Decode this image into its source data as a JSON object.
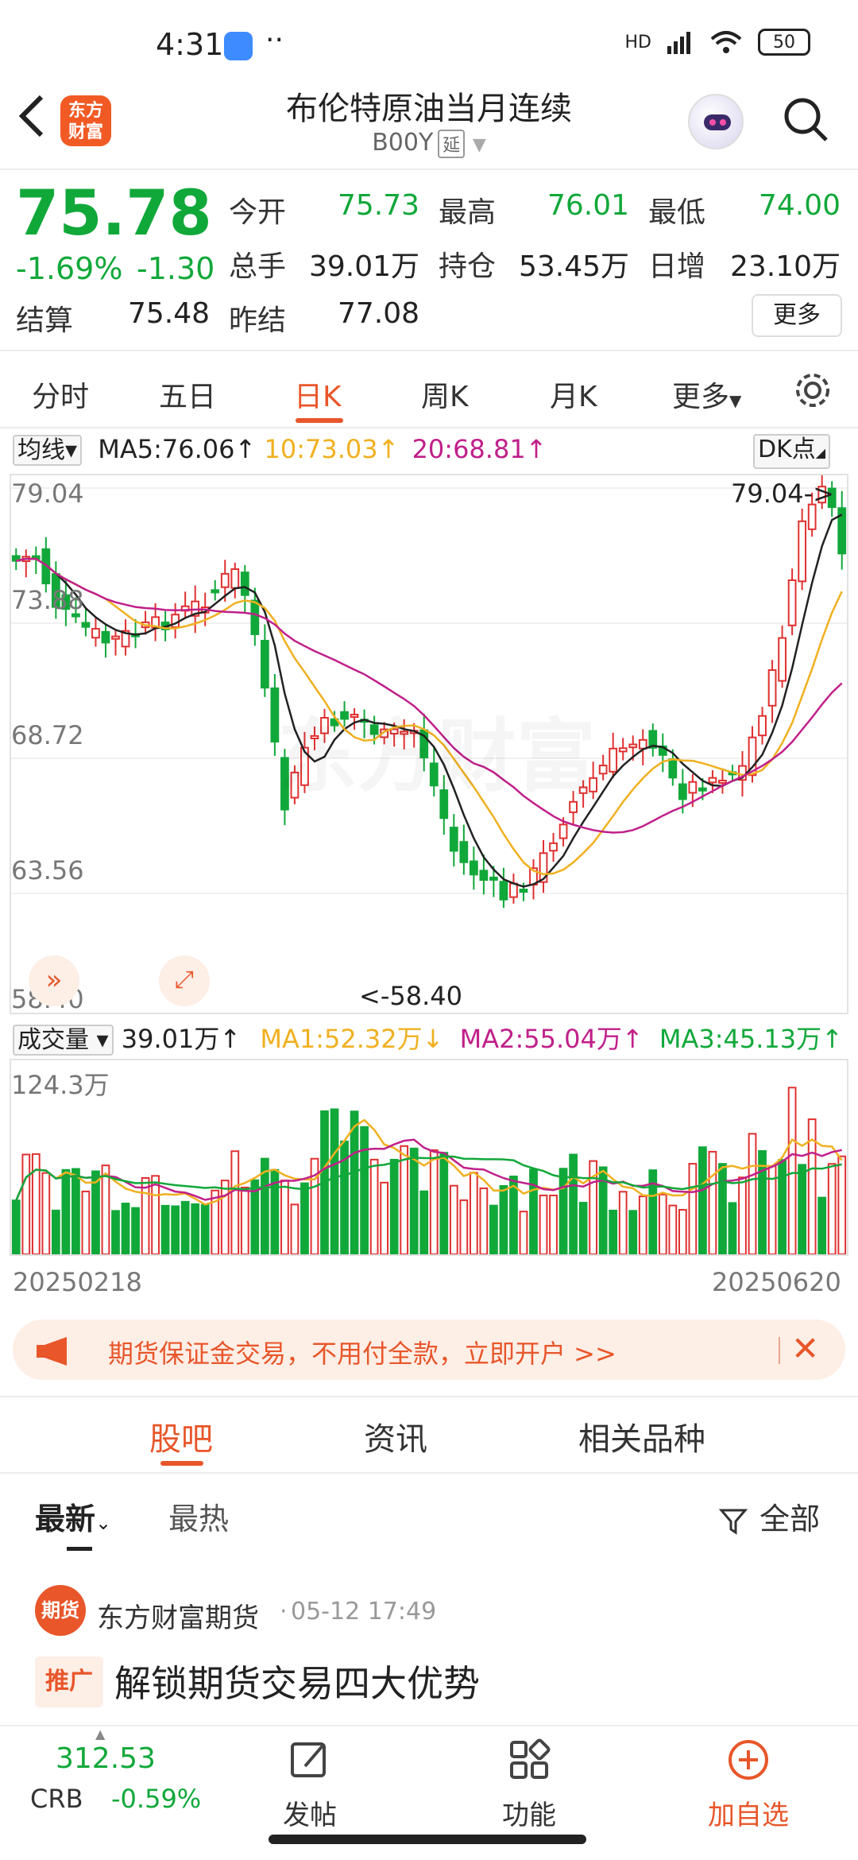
{
  "status_bar": {
    "time": "4:31",
    "battery": "50",
    "hd": "HD"
  },
  "header": {
    "title": "布伦特原油当月连续",
    "code": "B00Y",
    "delay_tag": "延",
    "logo_text": "东方财富"
  },
  "quote": {
    "price": "75.78",
    "change_pct": "-1.69%",
    "change": "-1.30",
    "open_label": "今开",
    "open": "75.73",
    "high_label": "最高",
    "high": "76.01",
    "low_label": "最低",
    "low": "74.00",
    "volume_label": "总手",
    "volume": "39.01万",
    "oi_label": "持仓",
    "oi": "53.45万",
    "daily_inc_label": "日增",
    "daily_inc": "23.10万",
    "settle_label": "结算",
    "settle": "75.48",
    "prev_settle_label": "昨结",
    "prev_settle": "77.08",
    "more": "更多"
  },
  "tabs": [
    "分时",
    "五日",
    "日K",
    "周K",
    "月K",
    "更多"
  ],
  "ma_row": {
    "selector": "均线",
    "ma5": "MA5:76.06↑",
    "ma10": "10:73.03↑",
    "ma20": "20:68.81↑",
    "dk": "DK点"
  },
  "price_axis": [
    "79.04",
    "73.88",
    "68.72",
    "63.56",
    "58.40"
  ],
  "annotations": {
    "high": "79.04->",
    "low": "<-58.40"
  },
  "watermark": "东方财富",
  "volume_row": {
    "selector": "成交量",
    "vol": "39.01万↑",
    "ma1": "MA1:52.32万↓",
    "ma2": "MA2:55.04万↑",
    "ma3": "MA3:45.13万↑"
  },
  "volume_axis": "124.3万",
  "dates": {
    "start": "20250218",
    "end": "20250620"
  },
  "colors": {
    "up": "#e03030",
    "down": "#11a83a",
    "ma5": "#222222",
    "ma10": "#f0b020",
    "ma20": "#c0208a",
    "accent": "#e8562a"
  },
  "banner": {
    "text": "期货保证金交易，不用付全款，立即开户 >>"
  },
  "sub_tabs": [
    "股吧",
    "资讯",
    "相关品种"
  ],
  "filter": {
    "latest": "最新",
    "hot": "最热",
    "all": "全部"
  },
  "post": {
    "avatar_text": "期货",
    "author": "东方财富期货",
    "time": "05-12 17:49",
    "tag": "推广",
    "title": "解锁期货交易四大优势"
  },
  "bottom_bar": {
    "crb_value": "312.53",
    "crb_label": "CRB",
    "crb_pct": "-0.59%",
    "post": "发帖",
    "function": "功能",
    "add": "加自选"
  }
}
